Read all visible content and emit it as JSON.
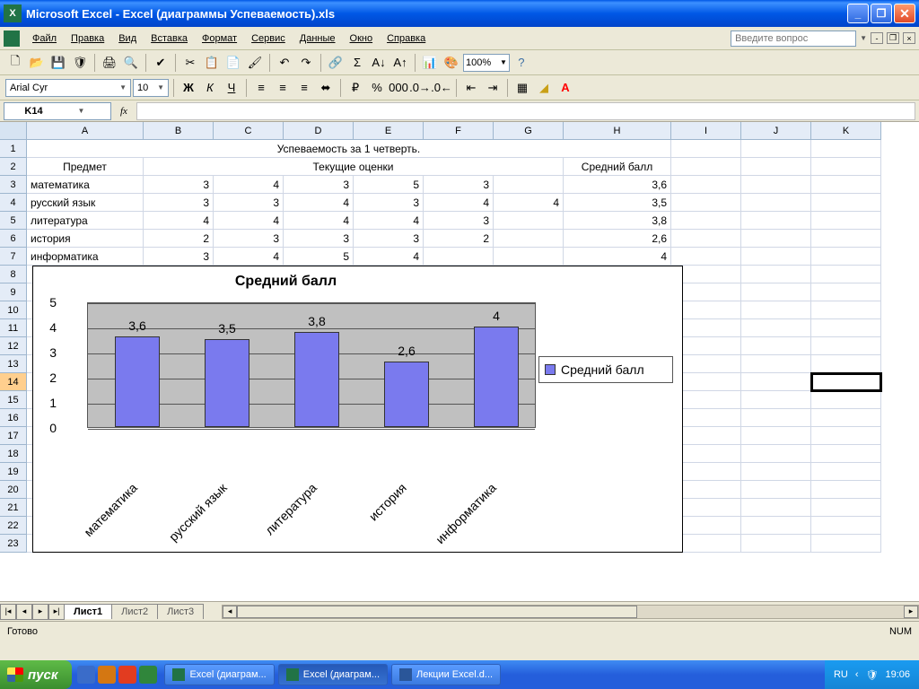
{
  "titlebar": {
    "title": "Microsoft Excel - Excel (диаграммы Успеваемость).xls"
  },
  "menu": {
    "file": "Файл",
    "edit": "Правка",
    "view": "Вид",
    "insert": "Вставка",
    "format": "Формат",
    "service": "Сервис",
    "data": "Данные",
    "window": "Окно",
    "help": "Справка",
    "question_placeholder": "Введите вопрос"
  },
  "format": {
    "font_name": "Arial Cyr",
    "font_size": "10",
    "zoom": "100%"
  },
  "namebox": "K14",
  "columns": [
    "A",
    "B",
    "C",
    "D",
    "E",
    "F",
    "G",
    "H",
    "I",
    "J",
    "K"
  ],
  "rows_visible": 23,
  "table": {
    "title": "Успеваемость за 1 четверть.",
    "h_subject": "Предмет",
    "h_grades": "Текущие оценки",
    "h_avg": "Средний балл",
    "rows": [
      {
        "subj": "математика",
        "g": [
          "3",
          "4",
          "3",
          "5",
          "3",
          ""
        ],
        "avg": "3,6"
      },
      {
        "subj": "русский язык",
        "g": [
          "3",
          "3",
          "4",
          "3",
          "4",
          "4"
        ],
        "avg": "3,5"
      },
      {
        "subj": "литература",
        "g": [
          "4",
          "4",
          "4",
          "4",
          "3",
          ""
        ],
        "avg": "3,8"
      },
      {
        "subj": "история",
        "g": [
          "2",
          "3",
          "3",
          "3",
          "2",
          ""
        ],
        "avg": "2,6"
      },
      {
        "subj": "информатика",
        "g": [
          "3",
          "4",
          "5",
          "4",
          "",
          ""
        ],
        "avg": "4"
      }
    ]
  },
  "chart_data": {
    "type": "bar",
    "title": "Средний балл",
    "legend": "Средний балл",
    "categories": [
      "математика",
      "русский язык",
      "литература",
      "история",
      "информатика"
    ],
    "labels": [
      "3,6",
      "3,5",
      "3,8",
      "2,6",
      "4"
    ],
    "values": [
      3.6,
      3.5,
      3.8,
      2.6,
      4
    ],
    "ylim": [
      0,
      5
    ],
    "yticks": [
      0,
      1,
      2,
      3,
      4,
      5
    ]
  },
  "tabs": {
    "active": "Лист1",
    "others": [
      "Лист2",
      "Лист3"
    ]
  },
  "status": {
    "ready": "Готово",
    "num": "NUM"
  },
  "taskbar": {
    "start": "пуск",
    "tasks": [
      "Excel (диаграм...",
      "Excel (диаграм...",
      "Лекции Excel.d..."
    ],
    "lang": "RU",
    "clock": "19:06"
  }
}
